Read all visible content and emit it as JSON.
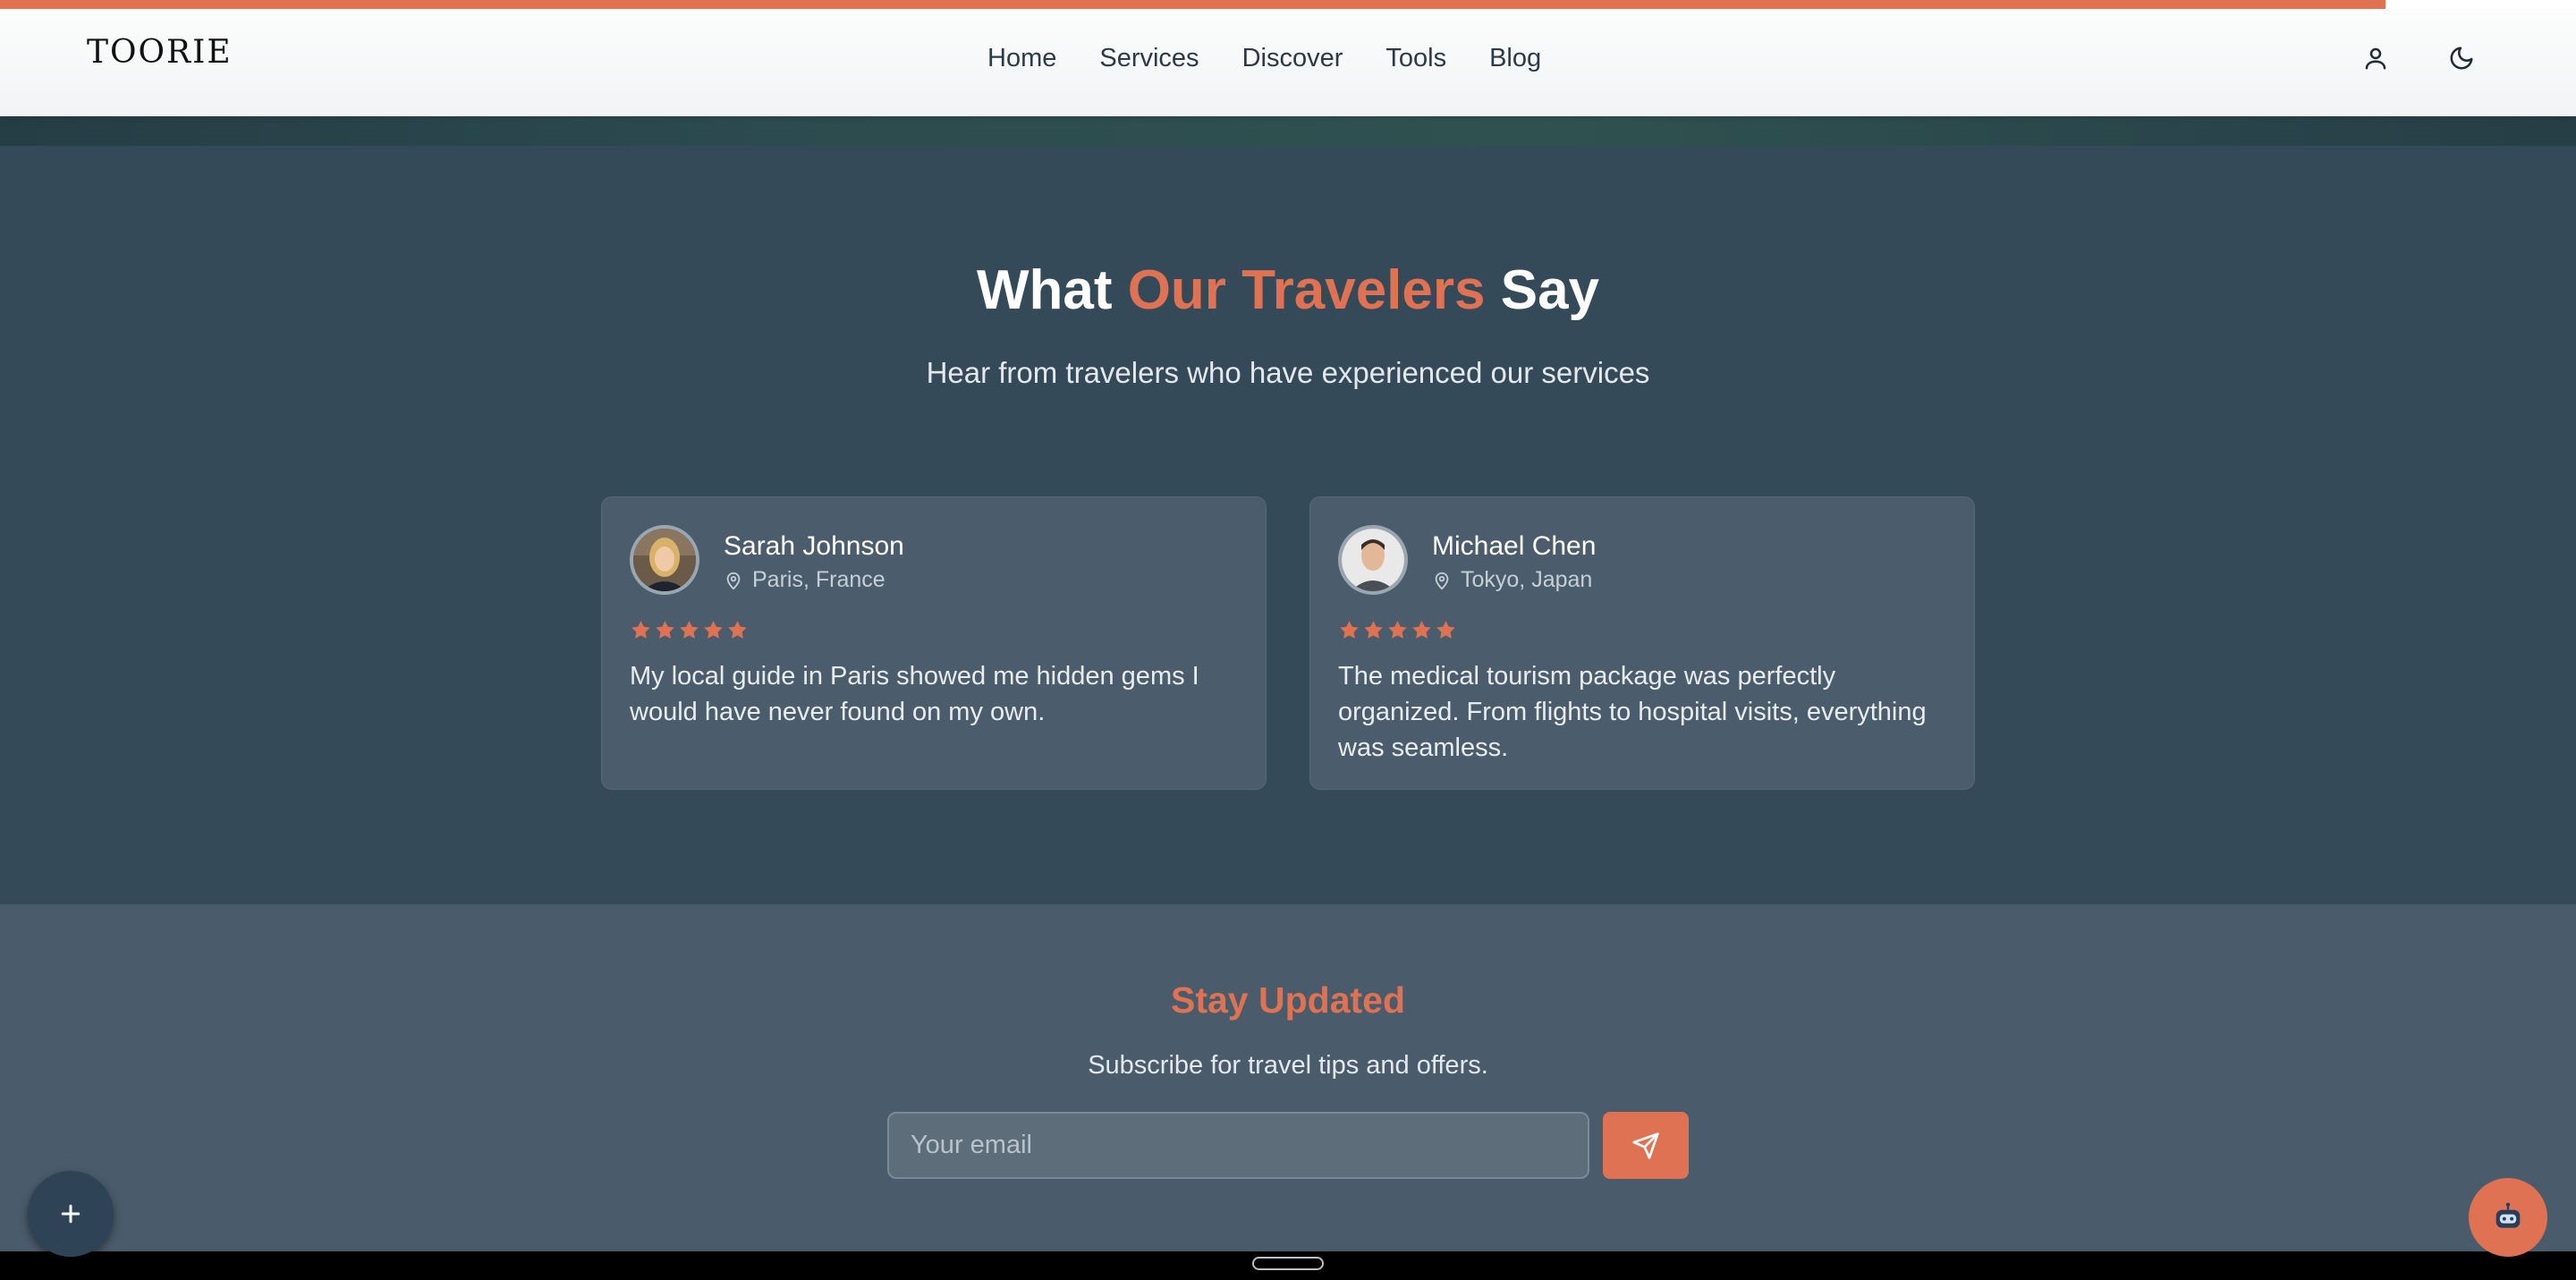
{
  "progress": {
    "fraction": 0.926,
    "color": "#e07254"
  },
  "header": {
    "logo": "TOORIE",
    "nav": [
      "Home",
      "Services",
      "Discover",
      "Tools",
      "Blog"
    ],
    "icons": [
      "user-icon",
      "moon-icon"
    ]
  },
  "testimonials": {
    "title_pre": "What ",
    "title_accent": "Our Travelers",
    "title_post": " Say",
    "subtitle": "Hear from travelers who have experienced our services",
    "cards": [
      {
        "name": "Sarah Johnson",
        "location": "Paris, France",
        "rating": 5,
        "text": "My local guide in Paris showed me hidden gems I would have never found on my own."
      },
      {
        "name": "Michael Chen",
        "location": "Tokyo, Japan",
        "rating": 5,
        "text": "The medical tourism package was perfectly organized. From flights to hospital visits, everything was seamless."
      }
    ]
  },
  "newsletter": {
    "title": "Stay Updated",
    "subtitle": "Subscribe for travel tips and offers.",
    "email_placeholder": "Your email"
  },
  "colors": {
    "accent": "#e07254",
    "section_dark": "#344a59",
    "card_bg": "#4b5d6c"
  }
}
